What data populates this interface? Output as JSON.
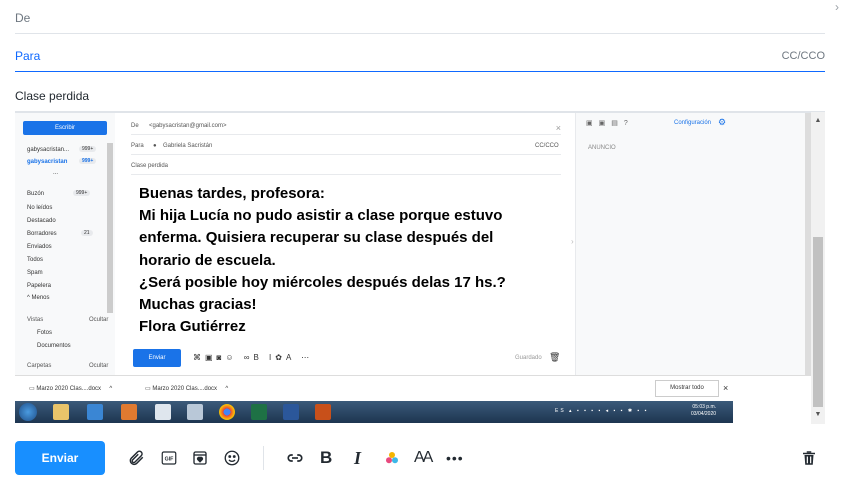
{
  "header": {
    "from_label": "De",
    "to_label": "Para",
    "cc_label": "CC/CCO",
    "subject": "Clase perdida"
  },
  "screenshot": {
    "sidebar": {
      "compose_label": "Escribir",
      "accounts": [
        {
          "name": "gabysacristan...",
          "count": "999+"
        },
        {
          "name": "gabysacristan",
          "count": "999+"
        }
      ],
      "more": "...",
      "folders": [
        {
          "name": "Buzón",
          "count": "999+"
        },
        {
          "name": "No leídos",
          "count": ""
        },
        {
          "name": "Destacado",
          "count": ""
        },
        {
          "name": "Borradores",
          "count": "21"
        },
        {
          "name": "Enviados",
          "count": ""
        },
        {
          "name": "Todos",
          "count": ""
        },
        {
          "name": "Spam",
          "count": ""
        },
        {
          "name": "Papelera",
          "count": ""
        }
      ],
      "less": "^ Menos",
      "views_label": "Vistas",
      "hide_label": "Ocultar",
      "views": [
        "Fotos",
        "Documentos"
      ],
      "folders_label": "Carpetas",
      "folders_hide": "Ocultar"
    },
    "compose": {
      "from_label": "De",
      "from_value": "<gabysacristan@gmail.com>",
      "to_label": "Para",
      "to_value": "Gabriela Sacristán",
      "cc_label": "CC/CCO",
      "subject": "Clase perdida",
      "body_lines": [
        "Buenas tardes, profesora:",
        "Mi hija Lucía no pudo asistir a clase porque estuvo",
        "enferma. Quisiera recuperar su clase después del",
        "horario de escuela.",
        "¿Será posible hoy miércoles después delas 17 hs.?",
        "Muchas gracias!",
        "Flora Gutiérrez"
      ],
      "send_label": "Enviar",
      "saved_label": "Guardado"
    },
    "right_panel": {
      "settings_label": "Configuración",
      "ad_label": "ANUNCIO"
    },
    "downloads": {
      "items": [
        "Marzo 2020 Clas....docx",
        "Marzo 2020 Clas....docx"
      ],
      "show_all": "Mostrar todo"
    },
    "taskbar": {
      "lang": "ES",
      "time": "05:03 p.m.",
      "date": "03/04/2020"
    }
  },
  "toolbar": {
    "send_label": "Enviar",
    "gif_label": "GIF",
    "bold_label": "B",
    "italic_label": "I",
    "font_label": "AA",
    "more_label": "•••"
  },
  "icons": [
    "paperclip-icon",
    "gif-icon",
    "sticker-icon",
    "emoji-icon",
    "link-icon",
    "bold-icon",
    "italic-icon",
    "color-icon",
    "font-size-icon",
    "more-icon",
    "trash-icon"
  ]
}
